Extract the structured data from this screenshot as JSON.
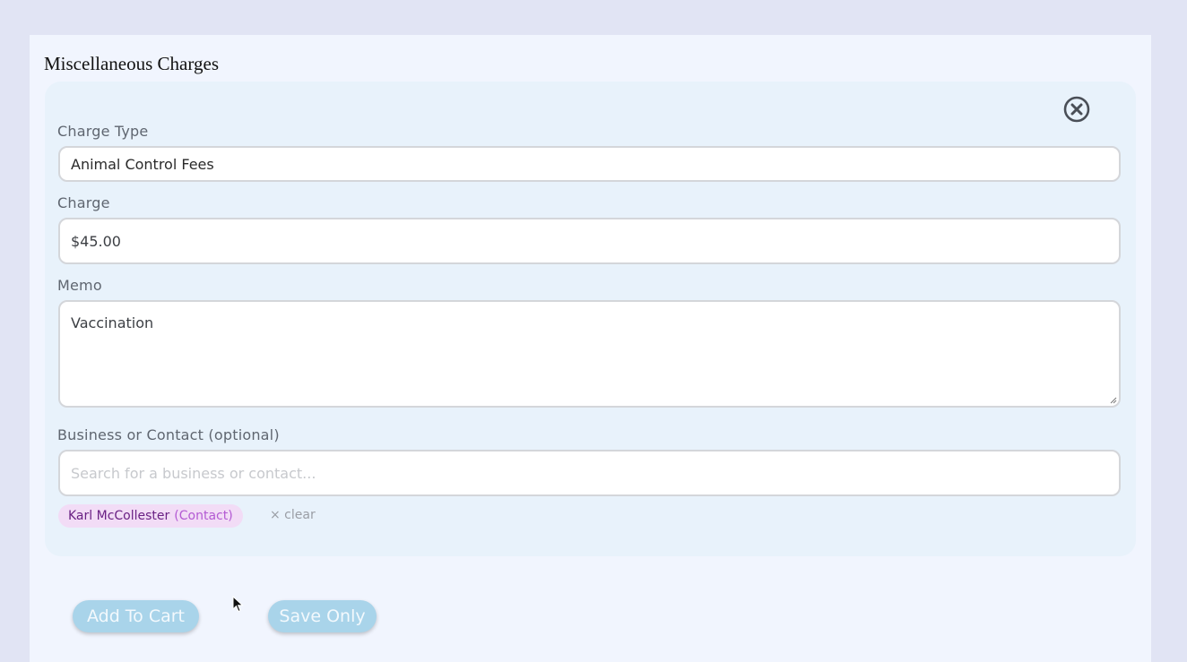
{
  "panel": {
    "title": "Miscellaneous Charges"
  },
  "form": {
    "close_icon": "close-circle-icon",
    "charge_type": {
      "label": "Charge Type",
      "value": "Animal Control Fees"
    },
    "charge": {
      "label": "Charge",
      "value": "$45.00"
    },
    "memo": {
      "label": "Memo",
      "value": "Vaccination"
    },
    "contact": {
      "label": "Business or Contact (optional)",
      "placeholder": "Search for a business or contact...",
      "selected_name": "Karl McCollester",
      "selected_type": "(Contact)",
      "clear_label": "× clear"
    }
  },
  "actions": {
    "add_to_cart": "Add To Cart",
    "save_only": "Save Only"
  },
  "colors": {
    "page_bg": "#e1e4f4",
    "panel_bg": "#f1f5fe",
    "card_bg": "#e8f2fb",
    "button_bg": "#a9d4ea",
    "chip_bg": "#f2dcf6",
    "chip_name": "#6a2184",
    "chip_type": "#b35ad3"
  }
}
